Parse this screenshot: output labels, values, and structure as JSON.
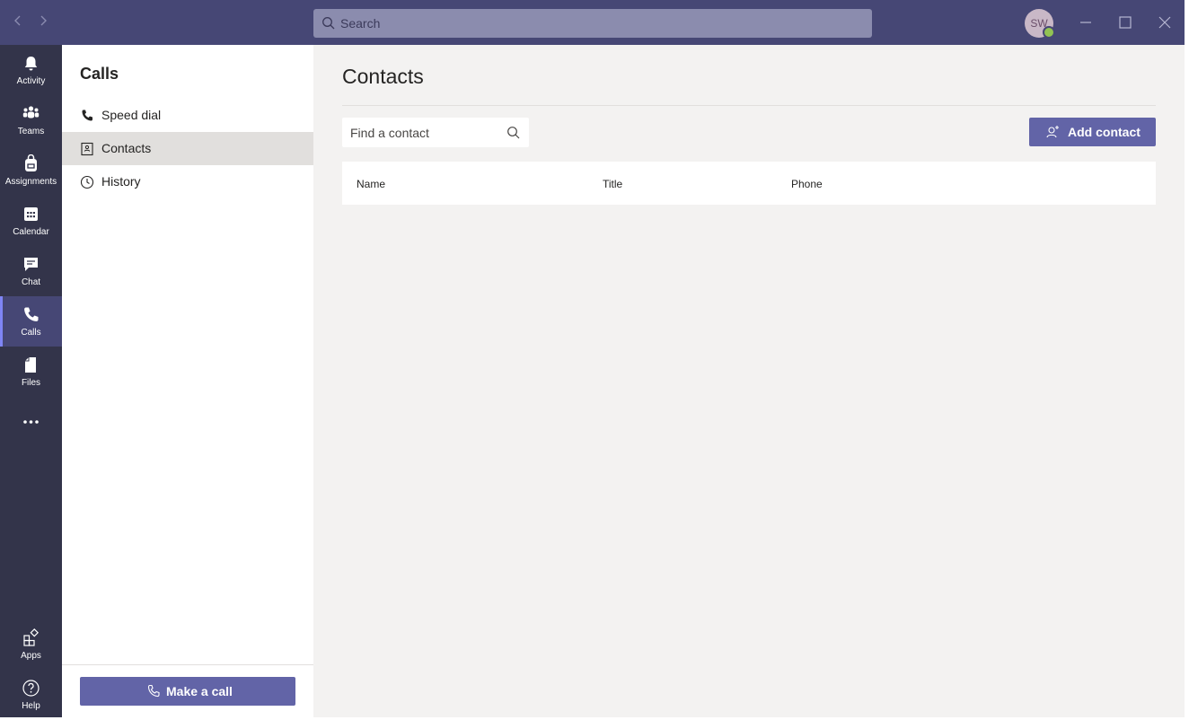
{
  "titlebar": {
    "search_placeholder": "Search",
    "avatar_initials": "SW",
    "back_icon": "chevron-left-icon",
    "forward_icon": "chevron-right-icon"
  },
  "rail": {
    "items": [
      {
        "label": "Activity",
        "icon": "bell-icon"
      },
      {
        "label": "Teams",
        "icon": "teams-icon"
      },
      {
        "label": "Assignments",
        "icon": "backpack-icon"
      },
      {
        "label": "Calendar",
        "icon": "calendar-icon"
      },
      {
        "label": "Chat",
        "icon": "chat-icon"
      },
      {
        "label": "Calls",
        "icon": "phone-icon",
        "active": true
      },
      {
        "label": "Files",
        "icon": "file-icon"
      },
      {
        "label": "",
        "icon": "more-icon"
      }
    ],
    "bottom": [
      {
        "label": "Apps",
        "icon": "apps-icon"
      },
      {
        "label": "Help",
        "icon": "help-icon"
      }
    ]
  },
  "panel": {
    "title": "Calls",
    "items": [
      {
        "label": "Speed dial",
        "icon": "phone-icon"
      },
      {
        "label": "Contacts",
        "icon": "contact-card-icon",
        "active": true
      },
      {
        "label": "History",
        "icon": "clock-icon"
      }
    ],
    "make_call_label": "Make a call"
  },
  "main": {
    "title": "Contacts",
    "find_placeholder": "Find a contact",
    "add_contact_label": "Add contact",
    "columns": [
      "Name",
      "Title",
      "Phone"
    ]
  },
  "colors": {
    "brand": "#6264a7",
    "titlebar": "#464775",
    "rail": "#33344a",
    "presence": "#92c353"
  }
}
